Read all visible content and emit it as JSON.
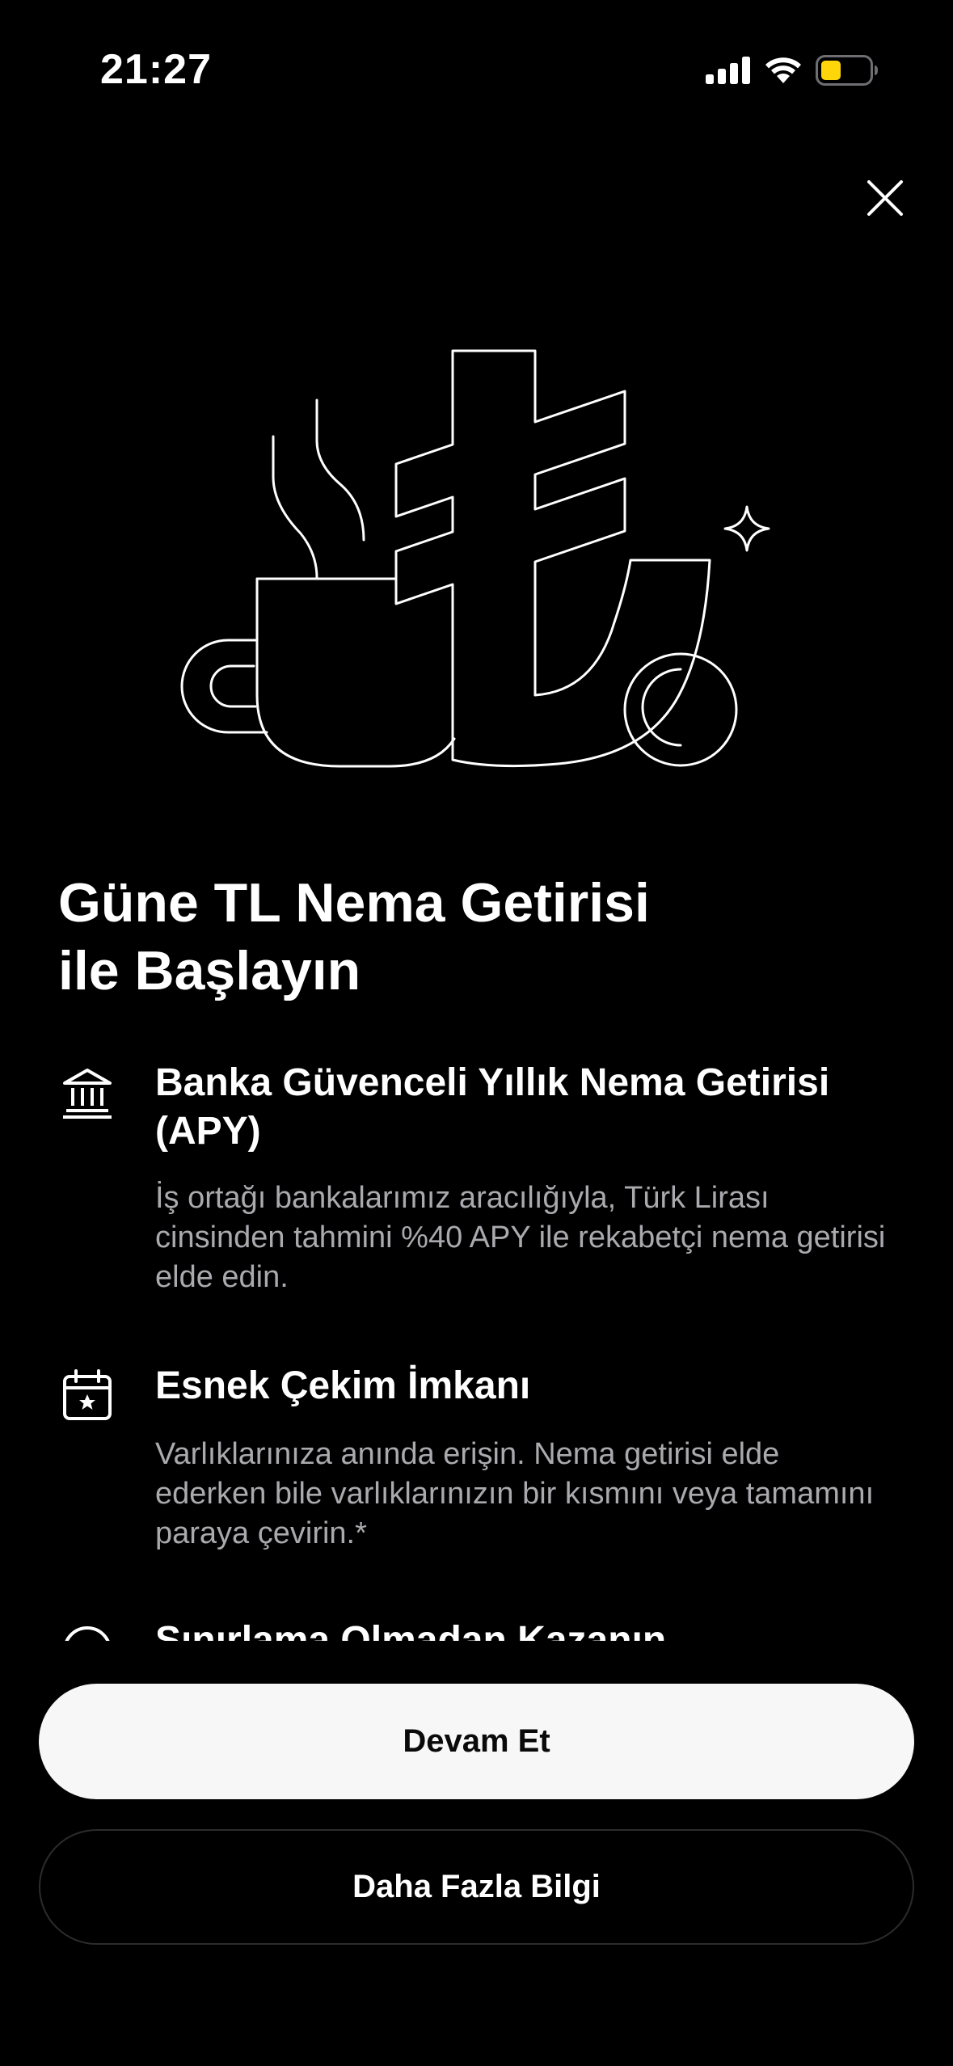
{
  "status_bar": {
    "time": "21:27",
    "signal_icon": "cellular-signal-icon",
    "wifi_icon": "wifi-icon",
    "battery_icon": "battery-low-icon",
    "battery_color": "#ffd60a"
  },
  "close_icon": "close-icon",
  "hero_illustration": "coffee-cup-lira-coin-illustration",
  "title": {
    "line1": "Güne TL Nema Getirisi",
    "line2": "ile Başlayın"
  },
  "features": [
    {
      "icon": "bank-icon",
      "title": "Banka Güvenceli Yıllık Nema Getirisi (APY)",
      "description": "İş ortağı bankalarımız aracılığıyla, Türk Lirası cinsinden tahmini %40 APY ile rekabetçi nema getirisi elde edin."
    },
    {
      "icon": "calendar-star-icon",
      "title": "Esnek Çekim İmkanı",
      "description": "Varlıklarınıza anında erişin. Nema getirisi elde ederken bile varlıklarınızın bir kısmını veya tamamını paraya çevirin.*"
    },
    {
      "icon": "arrow-up-circle-icon",
      "title": "Sınırlama Olmadan Kazanın"
    }
  ],
  "buttons": {
    "primary": "Devam Et",
    "secondary": "Daha Fazla Bilgi"
  }
}
